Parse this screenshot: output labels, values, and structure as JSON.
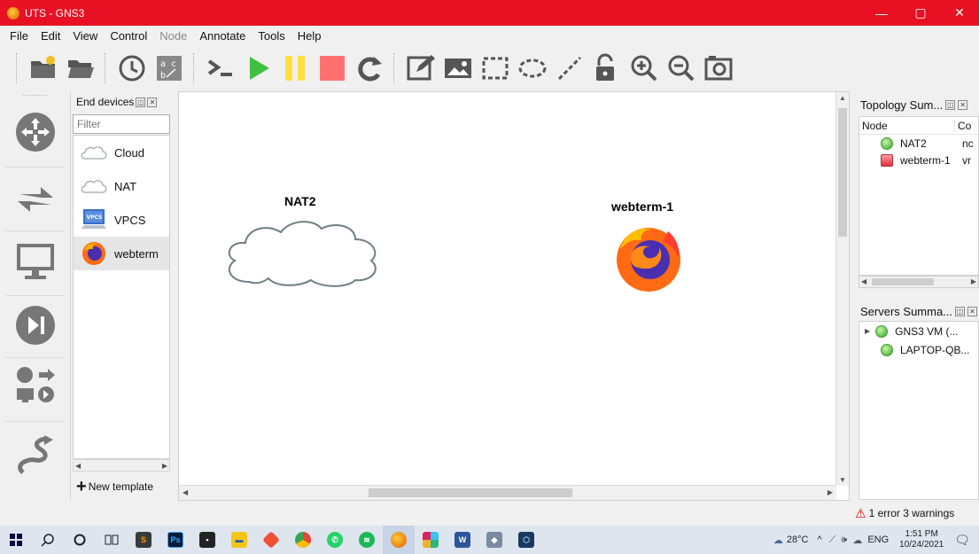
{
  "window": {
    "title": "UTS - GNS3",
    "minimize": "—",
    "restore": "▢",
    "close": "✕"
  },
  "menu": [
    {
      "label": "File",
      "enabled": true
    },
    {
      "label": "Edit",
      "enabled": true
    },
    {
      "label": "View",
      "enabled": true
    },
    {
      "label": "Control",
      "enabled": true
    },
    {
      "label": "Node",
      "enabled": false
    },
    {
      "label": "Annotate",
      "enabled": true
    },
    {
      "label": "Tools",
      "enabled": true
    },
    {
      "label": "Help",
      "enabled": true
    }
  ],
  "toolbar": [
    "new-project-icon",
    "open-project-icon",
    "snapshot-icon",
    "show-interface-labels-icon",
    "console-all-icon",
    "start-all-icon",
    "suspend-all-icon",
    "stop-all-icon",
    "reload-all-icon",
    "add-note-icon",
    "insert-picture-icon",
    "draw-rectangle-icon",
    "draw-ellipse-icon",
    "draw-line-icon",
    "lock-unlock-icon",
    "zoom-in-icon",
    "zoom-out-icon",
    "screenshot-icon"
  ],
  "device_bar": [
    "routers-icon",
    "switches-icon",
    "end-devices-icon",
    "security-devices-icon",
    "all-devices-icon",
    "add-link-icon"
  ],
  "templates": {
    "title": "End devices",
    "filter_placeholder": "Filter",
    "items": [
      {
        "label": "Cloud",
        "icon": "cloud-icon"
      },
      {
        "label": "NAT",
        "icon": "nat-icon"
      },
      {
        "label": "VPCS",
        "icon": "vpcs-icon"
      },
      {
        "label": "webterm",
        "icon": "firefox-icon"
      }
    ],
    "new_template": "New template"
  },
  "canvas": {
    "nodes": [
      {
        "label": "NAT2",
        "icon": "cloud-icon"
      },
      {
        "label": "webterm-1",
        "icon": "firefox-icon"
      }
    ]
  },
  "topology_summary": {
    "title": "Topology Sum...",
    "columns": [
      "Node",
      "Co"
    ],
    "rows": [
      {
        "name": "NAT2",
        "console": "nc",
        "status": "started"
      },
      {
        "name": "webterm-1",
        "console": "vr",
        "status": "stopped"
      }
    ]
  },
  "servers_summary": {
    "title": "Servers Summa...",
    "rows": [
      {
        "name": "GNS3 VM (...",
        "expandable": true
      },
      {
        "name": "LAPTOP-QB...",
        "expandable": false
      }
    ]
  },
  "status": {
    "message": "1 error 3 warnings"
  },
  "taskbar": {
    "apps": [
      "windows-start-icon",
      "search-icon",
      "cortana-icon",
      "task-view-icon",
      "sublime-icon",
      "photoshop-icon",
      "store-icon",
      "file-explorer-icon",
      "git-icon",
      "chrome-icon",
      "whatsapp-icon",
      "spotify-icon",
      "gns3-icon",
      "slack-icon",
      "word-icon",
      "app-icon",
      "virtualbox-icon"
    ],
    "weather": "28°C",
    "lang": "ENG",
    "time": "1:51 PM",
    "date": "10/24/2021"
  },
  "colors": {
    "titlebar": "#e81123",
    "start_green": "#3fc13f",
    "suspend_yellow": "#ffe040",
    "stop_red": "#ff7070"
  }
}
